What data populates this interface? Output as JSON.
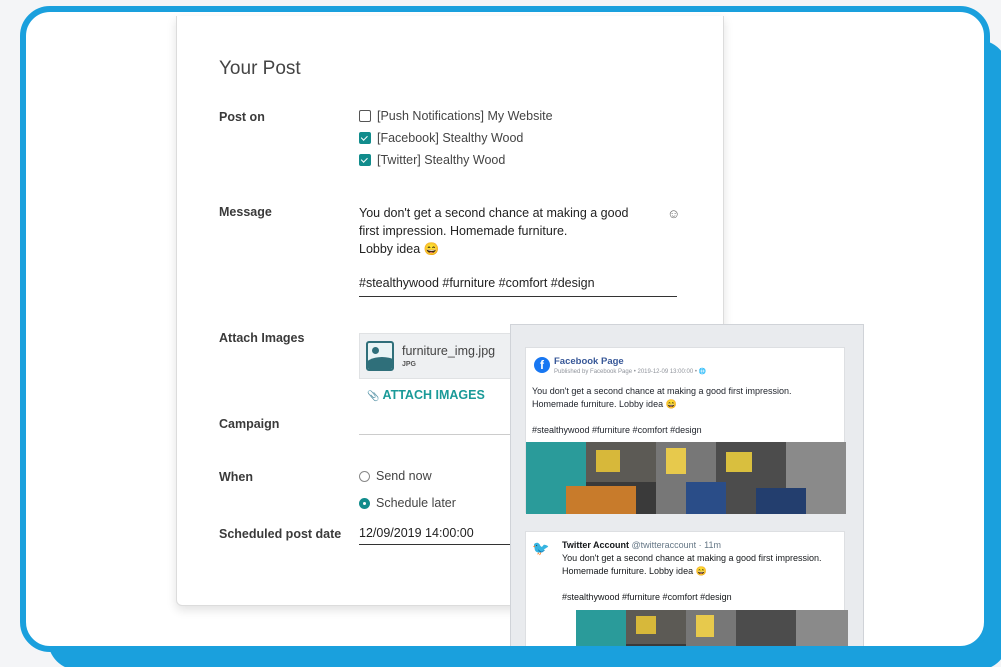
{
  "form": {
    "title": "Your Post",
    "labels": {
      "post_on": "Post on",
      "message": "Message",
      "attach_images": "Attach Images",
      "campaign": "Campaign",
      "when": "When",
      "scheduled_date": "Scheduled post date"
    },
    "accounts": [
      {
        "label": "[Push Notifications] My Website",
        "checked": false
      },
      {
        "label": "[Facebook] Stealthy Wood",
        "checked": true
      },
      {
        "label": "[Twitter] Stealthy Wood",
        "checked": true
      }
    ],
    "message_lines": [
      "You don't get a second chance at making a good",
      "first impression. Homemade furniture.",
      "Lobby idea 😄"
    ],
    "emoji_icon": "☺",
    "hashtags": "#stealthywood #furniture #comfort #design",
    "attachment": {
      "name": "furniture_img.jpg",
      "type": "JPG"
    },
    "attach_button": "ATTACH IMAGES",
    "attach_icon": "📎",
    "when_options": [
      {
        "label": "Send now",
        "selected": false
      },
      {
        "label": "Schedule later",
        "selected": true
      }
    ],
    "scheduled_date": "12/09/2019 14:00:00"
  },
  "preview": {
    "facebook": {
      "logo": "f",
      "page": "Facebook Page",
      "published": "Published by Facebook Page • 2019-12-09 13:00:00 • 🌐",
      "text_lines": [
        "You don't get a second chance at making a good first impression.",
        "Homemade furniture. Lobby idea 😄",
        "",
        "#stealthywood #furniture #comfort #design"
      ]
    },
    "twitter": {
      "logo": "🐦",
      "account": "Twitter Account",
      "handle": "@twitteraccount · 11m",
      "text_lines": [
        "You don't get a second chance at making a good first impression.",
        "Homemade furniture. Lobby idea 😄",
        "",
        "#stealthywood #furniture #comfort #design"
      ]
    }
  },
  "colors": {
    "frame": "#1aa0dd",
    "accent": "#118c8c",
    "facebook": "#1877f2",
    "twitter": "#1da1f2"
  }
}
